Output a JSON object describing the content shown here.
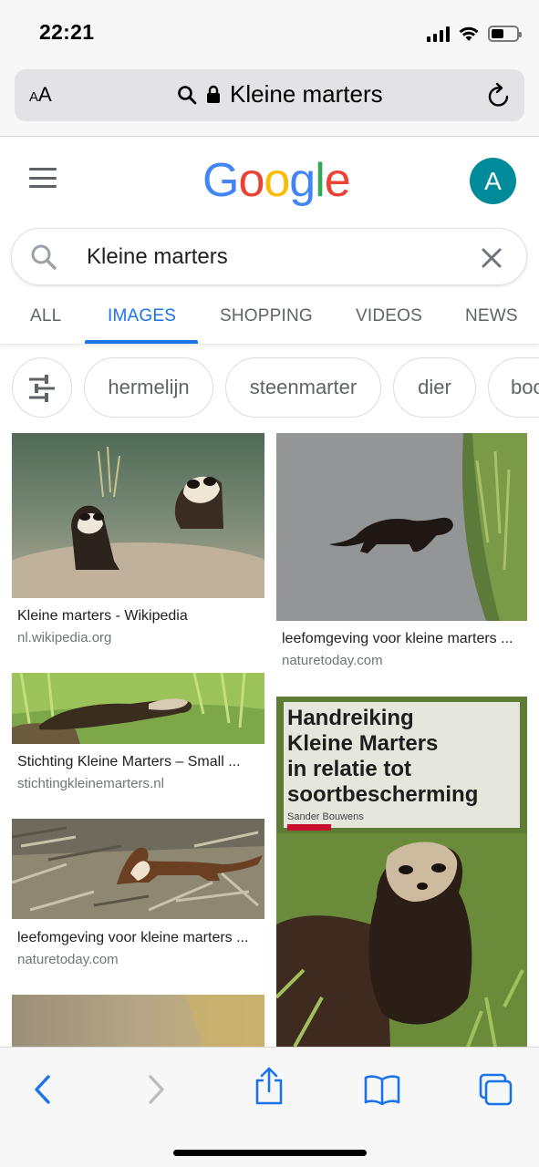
{
  "status_bar": {
    "time": "22:21",
    "signal_icon": "signal-bars-icon",
    "wifi_icon": "wifi-icon",
    "battery_icon": "battery-icon"
  },
  "browser": {
    "text_size_label_small": "A",
    "text_size_label_large": "A",
    "url_text": "Kleine marters",
    "search_icon": "search-icon",
    "lock_icon": "lock-icon",
    "reload_icon": "reload-icon"
  },
  "google": {
    "logo_letters": [
      "G",
      "o",
      "o",
      "g",
      "l",
      "e"
    ],
    "logo_colors": [
      "#4285F4",
      "#EA4335",
      "#FBBC05",
      "#4285F4",
      "#34A853",
      "#EA4335"
    ],
    "avatar_letter": "A",
    "avatar_color": "#008b9a",
    "search_query": "Kleine marters",
    "accent": "#1a73e8"
  },
  "tabs": [
    {
      "label": "ALL",
      "active": false
    },
    {
      "label": "IMAGES",
      "active": true
    },
    {
      "label": "SHOPPING",
      "active": false
    },
    {
      "label": "VIDEOS",
      "active": false
    },
    {
      "label": "NEWS",
      "active": false
    }
  ],
  "chips": [
    "hermelijn",
    "steenmarter",
    "dier",
    "boo"
  ],
  "results": [
    {
      "title": "Kleine marters - Wikipedia",
      "source": "nl.wikipedia.org"
    },
    {
      "title": "leefomgeving voor kleine marters ...",
      "source": "naturetoday.com"
    },
    {
      "title": "Stichting Kleine Marters – Small ...",
      "source": "stichtingkleinemarters.nl"
    },
    {
      "title": "leefomgeving voor kleine marters ...",
      "source": "naturetoday.com"
    }
  ],
  "book_cover": {
    "lines": [
      "Handreiking",
      "Kleine Marters",
      "in relatie tot",
      "soortbescherming"
    ],
    "author": "Sander Bouwens"
  },
  "toolbar": {
    "back_icon": "back-chevron-icon",
    "forward_icon": "forward-chevron-icon",
    "share_icon": "share-icon",
    "bookmarks_icon": "bookmarks-icon",
    "tabs_icon": "tabs-icon"
  }
}
